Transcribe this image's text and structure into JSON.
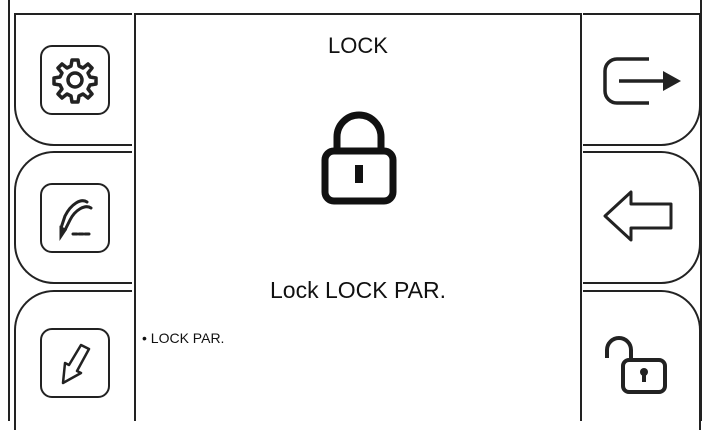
{
  "screen": {
    "title": "LOCK",
    "message": "Lock LOCK PAR.",
    "list_items": [
      "• LOCK PAR."
    ]
  },
  "left_buttons": [
    {
      "icon": "gear-icon"
    },
    {
      "icon": "welding-torch-icon"
    },
    {
      "icon": "arrow-down-left-icon"
    }
  ],
  "right_buttons": [
    {
      "icon": "exit-arrow-right-icon"
    },
    {
      "icon": "back-arrow-left-icon"
    },
    {
      "icon": "unlock-icon"
    }
  ],
  "colors": {
    "stroke": "#222222",
    "background": "#ffffff"
  }
}
